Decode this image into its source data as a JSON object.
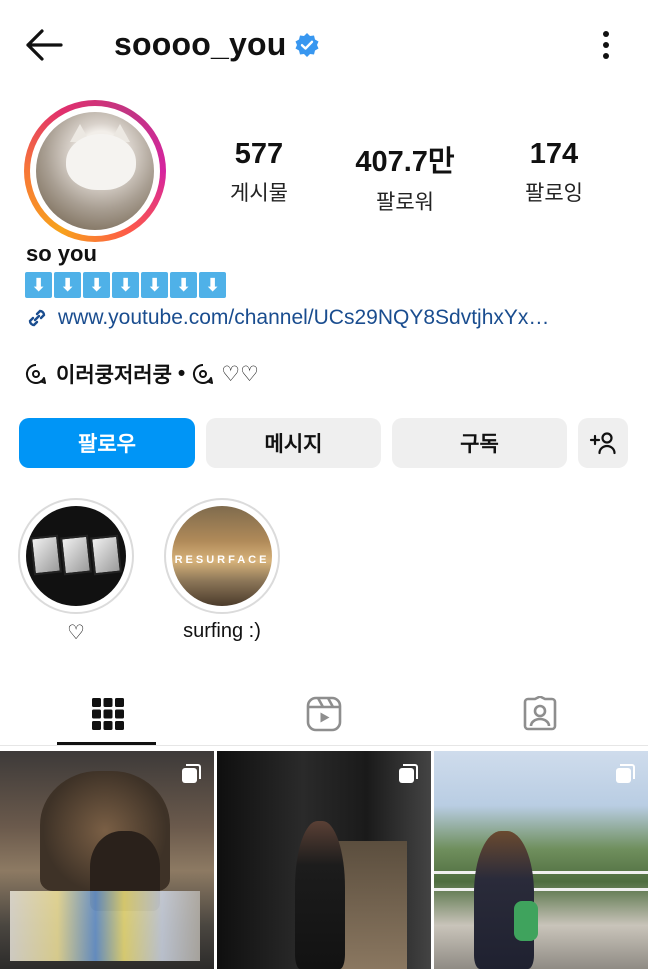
{
  "header": {
    "username": "soooo_you",
    "back_icon": "arrow-left-icon",
    "verified_icon": "verified-badge-icon",
    "menu_icon": "more-vertical-icon"
  },
  "profile": {
    "avatar_icon": "avatar",
    "stats": [
      {
        "value": "577",
        "label": "게시물"
      },
      {
        "value": "407.7만",
        "label": "팔로워"
      },
      {
        "value": "174",
        "label": "팔로잉"
      }
    ]
  },
  "bio": {
    "name": "so you",
    "arrows": [
      "⬇",
      "⬇",
      "⬇",
      "⬇",
      "⬇",
      "⬇",
      "⬇"
    ],
    "link": "www.youtube.com/channel/UCs29NQY8SdvtjhxYx…",
    "threads_text": "이러쿵저러쿵",
    "separator": "•",
    "threads_hearts": "♡♡"
  },
  "actions": {
    "follow": "팔로우",
    "message": "메시지",
    "subscribe": "구독",
    "add_user_icon": "add-person-icon"
  },
  "highlights": [
    {
      "label": "♡",
      "text_on_cover": ""
    },
    {
      "label": "surfing :)",
      "text_on_cover": "RESURFACE"
    }
  ],
  "tabs": [
    {
      "name": "grid",
      "icon": "grid-icon",
      "active": true
    },
    {
      "name": "reels",
      "icon": "reels-icon",
      "active": false
    },
    {
      "name": "tagged",
      "icon": "tagged-person-icon",
      "active": false
    }
  ],
  "colors": {
    "follow_button": "#0095f6",
    "secondary_button": "#efefef",
    "link": "#1a4d8f",
    "verified": "#3897f0",
    "arrow_box": "#4fb1e8"
  }
}
